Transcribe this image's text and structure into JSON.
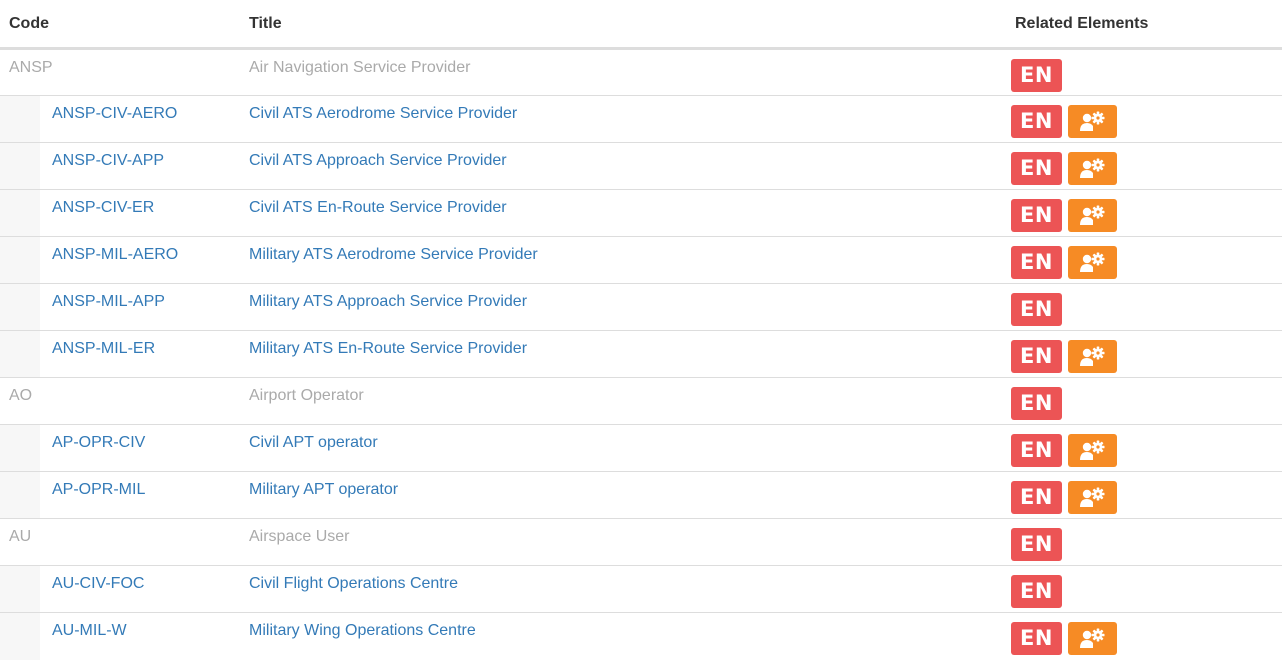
{
  "headers": {
    "code": "Code",
    "title": "Title",
    "related": "Related Elements"
  },
  "colors": {
    "link": "#337ab7",
    "parent_text": "#aaaaaa",
    "badge_en": "#ec5455",
    "badge_role": "#f68b25"
  },
  "badge_en_label": "EN",
  "role_icon": "user-gear-icon",
  "rows": [
    {
      "code": "ANSP",
      "title": "Air Navigation Service Provider",
      "kind": "parent",
      "role": false
    },
    {
      "code": "ANSP-CIV-AERO",
      "title": "Civil ATS Aerodrome Service Provider",
      "kind": "child",
      "role": true
    },
    {
      "code": "ANSP-CIV-APP",
      "title": "Civil ATS Approach Service Provider",
      "kind": "child",
      "role": true
    },
    {
      "code": "ANSP-CIV-ER",
      "title": "Civil ATS En-Route Service Provider",
      "kind": "child",
      "role": true
    },
    {
      "code": "ANSP-MIL-AERO",
      "title": "Military ATS Aerodrome Service Provider",
      "kind": "child",
      "role": true
    },
    {
      "code": "ANSP-MIL-APP",
      "title": "Military ATS Approach Service Provider",
      "kind": "child",
      "role": false
    },
    {
      "code": "ANSP-MIL-ER",
      "title": "Military ATS En-Route Service Provider",
      "kind": "child",
      "role": true
    },
    {
      "code": "AO",
      "title": "Airport Operator",
      "kind": "parent",
      "role": false
    },
    {
      "code": "AP-OPR-CIV",
      "title": "Civil APT operator",
      "kind": "child",
      "role": true
    },
    {
      "code": "AP-OPR-MIL",
      "title": "Military APT operator",
      "kind": "child",
      "role": true
    },
    {
      "code": "AU",
      "title": "Airspace User",
      "kind": "parent",
      "role": false
    },
    {
      "code": "AU-CIV-FOC",
      "title": "Civil Flight Operations Centre",
      "kind": "child",
      "role": false
    },
    {
      "code": "AU-MIL-W",
      "title": "Military Wing Operations Centre",
      "kind": "child",
      "role": true
    }
  ]
}
